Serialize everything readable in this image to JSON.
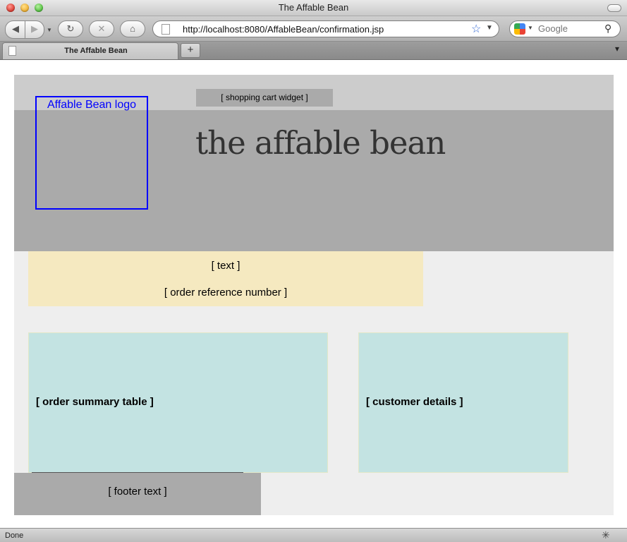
{
  "window": {
    "title": "The Affable Bean"
  },
  "toolbar": {
    "url": "http://localhost:8080/AffableBean/confirmation.jsp",
    "search_placeholder": "Google"
  },
  "tabs": [
    {
      "label": "The Affable Bean"
    }
  ],
  "page": {
    "logo_text": "Affable Bean logo",
    "cart_widget": "[ shopping cart widget ]",
    "site_title": "the affable bean",
    "notice_text": "[ text ]",
    "order_ref": "[ order reference number ]",
    "order_summary": "[ order summary table ]",
    "customer_details": "[ customer details ]",
    "footer_text": "[ footer text ]"
  },
  "status": {
    "text": "Done"
  },
  "icons": {
    "back": "back-arrow-icon",
    "forward": "forward-arrow-icon",
    "reload": "reload-icon",
    "stop": "stop-icon",
    "home": "home-icon",
    "bookmark": "star-icon",
    "search": "magnifier-icon"
  },
  "colors": {
    "header_top": "#cccccc",
    "header_main": "#aaaaaa",
    "main_bg": "#eeeeee",
    "notice_bg": "#f5e9c0",
    "panel_bg": "#c3e3e2",
    "logo_border": "#0000ff"
  }
}
